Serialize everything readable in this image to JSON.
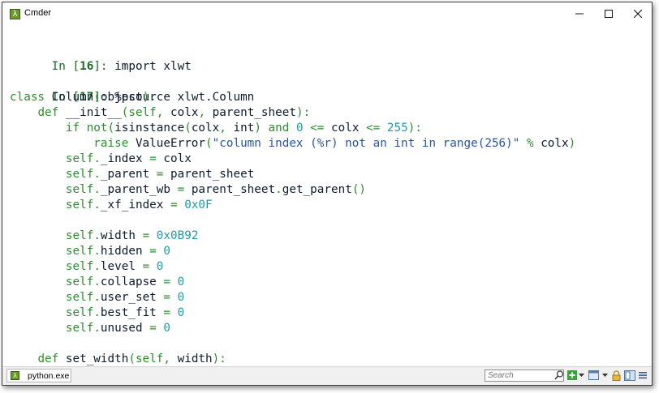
{
  "window": {
    "title": "Cmder",
    "controls": {
      "minimize": "minimize-icon",
      "maximize": "maximize-icon",
      "close": "close-icon"
    }
  },
  "console": {
    "lines": [
      {
        "prompt": "In [",
        "num": "16",
        "close": "]: ",
        "code": "import xlwt"
      },
      {
        "prompt": "In [",
        "num": "17",
        "close": "]: ",
        "code": "%psource xlwt.Column"
      },
      {
        "text": "class Column(object):"
      },
      {
        "text": "    def __init__(self, colx, parent_sheet):"
      },
      {
        "text": "        if not(isinstance(colx, int) and 0 <= colx <= 255):"
      },
      {
        "text": "            raise ValueError(\"column index (%r) not an int in range(256)\" % colx)"
      },
      {
        "text": "        self._index = colx"
      },
      {
        "text": "        self._parent = parent_sheet"
      },
      {
        "text": "        self._parent_wb = parent_sheet.get_parent()"
      },
      {
        "text": "        self._xf_index = 0x0F"
      },
      {
        "text": "        self.width = 0x0B92"
      },
      {
        "text": "        self.hidden = 0"
      },
      {
        "text": "        self.level = 0"
      },
      {
        "text": "        self.collapse = 0"
      },
      {
        "text": "        self.user_set = 0"
      },
      {
        "text": "        self.best_fit = 0"
      },
      {
        "text": "        self.unused = 0"
      },
      {
        "text": "    def set_width(self, width):"
      }
    ]
  },
  "statusbar": {
    "tab_label": "python.exe",
    "search_placeholder": "Search",
    "icons": [
      "search-icon",
      "new-console-icon",
      "dropdown-arrow-icon",
      "view-layout-icon",
      "dropdown-arrow-icon",
      "lock-icon",
      "split-view-icon",
      "menu-icon"
    ]
  },
  "colors": {
    "prompt": "#1d6a23",
    "keyword": "#2e8b2e",
    "number": "#1a9ba8",
    "string": "#2953a8",
    "text": "#0c1b2e",
    "app_icon": "#6b9a2a"
  }
}
